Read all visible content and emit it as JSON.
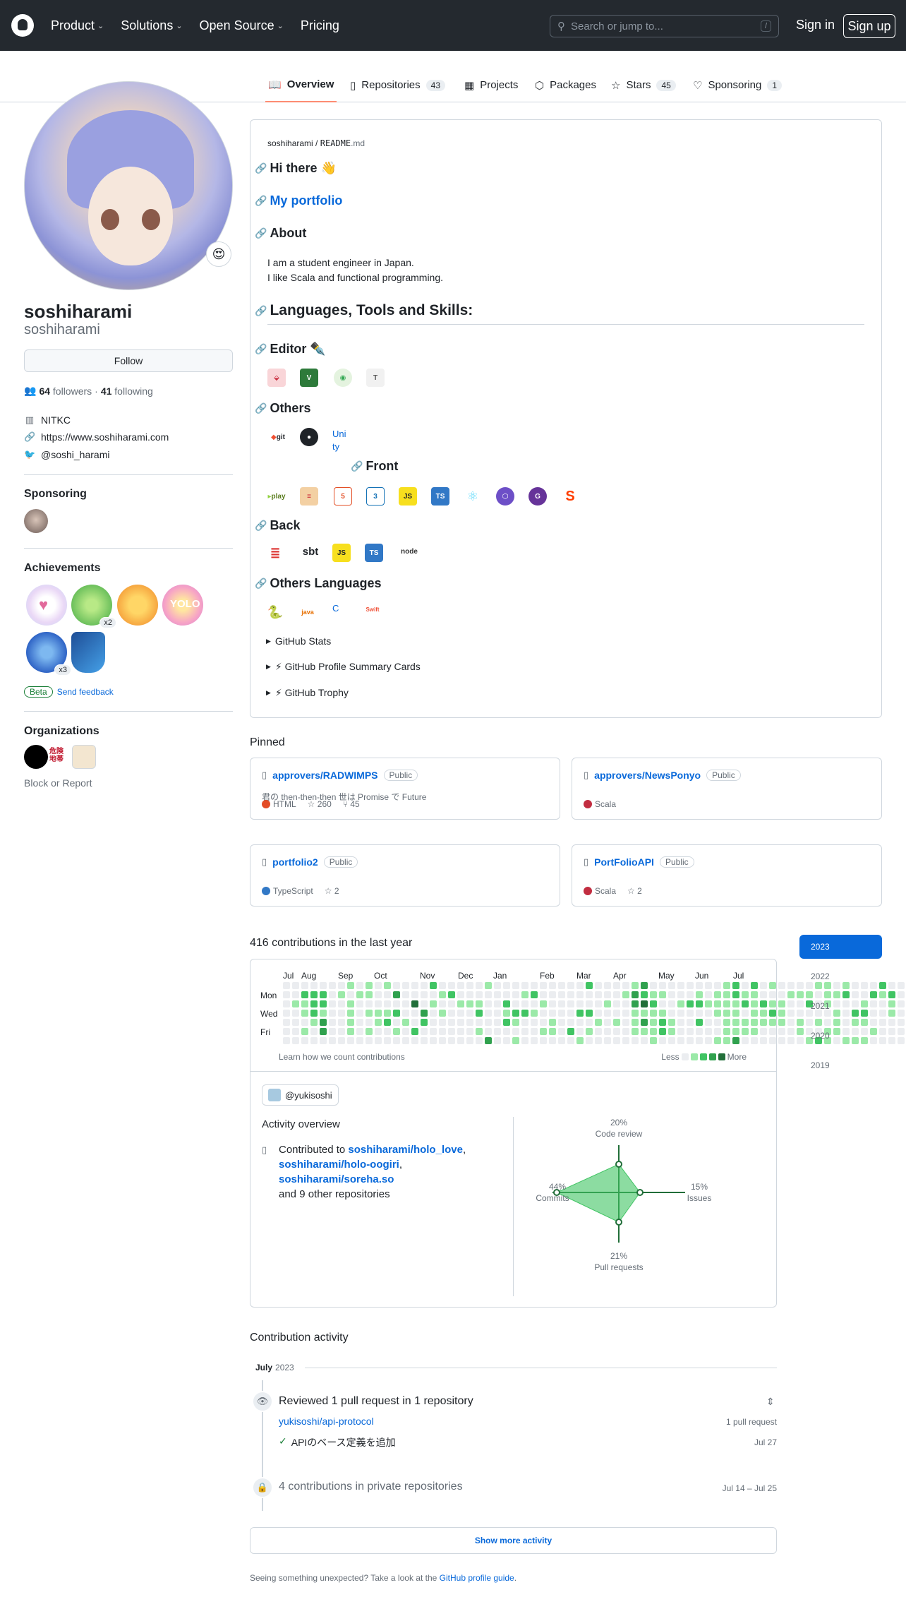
{
  "nav": {
    "product": "Product",
    "solutions": "Solutions",
    "open_source": "Open Source",
    "pricing": "Pricing",
    "search_placeholder": "Search or jump to...",
    "search_shortcut": "/",
    "sign_in": "Sign in",
    "sign_up": "Sign up"
  },
  "tabs": [
    {
      "label": "Overview",
      "count": ""
    },
    {
      "label": "Repositories",
      "count": "43"
    },
    {
      "label": "Projects",
      "count": ""
    },
    {
      "label": "Packages",
      "count": ""
    },
    {
      "label": "Stars",
      "count": "45"
    },
    {
      "label": "Sponsoring",
      "count": "1"
    }
  ],
  "profile": {
    "status_emoji": "😍",
    "name": "soshiharami",
    "login": "soshiharami",
    "follow_label": "Follow",
    "followers_count": "64",
    "followers_label": "followers",
    "dot": "·",
    "following_count": "41",
    "following_label": "following",
    "org": "NITKC",
    "website": "https://www.soshiharami.com",
    "twitter": "@soshi_harami"
  },
  "sidebar": {
    "sponsoring_h": "Sponsoring",
    "achievements_h": "Achievements",
    "badge_x2": "x2",
    "badge_x3": "x3",
    "beta": "Beta",
    "send_feedback": "Send feedback",
    "organizations_h": "Organizations",
    "org_label_1": "危険\n地帯",
    "block": "Block or Report"
  },
  "readme": {
    "path_user": "soshiharami",
    "path_sep": " / ",
    "path_file": "README",
    "path_ext": ".md",
    "h_hi": "Hi there 👋",
    "h_portfolio": "My portfolio",
    "h_about": "About",
    "about_1": "I am a student engineer in Japan.",
    "about_2": "I like Scala and functional programming.",
    "h_langs": "Languages, Tools and Skills:",
    "h_editor": "Editor ✒️",
    "h_others": "Others",
    "others_git": "git",
    "unity_alt": "Uni ty",
    "h_front": "Front",
    "play": "play",
    "js": "JS",
    "ts": "TS",
    "h_back": "Back",
    "sbt": "sbt",
    "node": "node",
    "h_other_langs": "Others Languages",
    "java": "java",
    "c_alt": "C",
    "swift": "Swift",
    "det_stats": "GitHub Stats",
    "det_cards": "⚡ GitHub Profile Summary Cards",
    "det_trophy": "⚡ GitHub Trophy"
  },
  "pinned": {
    "heading": "Pinned",
    "items": [
      {
        "owner": "approvers/",
        "name": "RADWIMPS",
        "badge": "Public",
        "desc": "君の then-then-then 世は Promise で Future",
        "lang": "HTML",
        "lang_color": "#e34c26",
        "stars": "260",
        "forks": "45"
      },
      {
        "owner": "approvers/",
        "name": "NewsPonyo",
        "badge": "Public",
        "desc": "",
        "lang": "Scala",
        "lang_color": "#c22d40",
        "stars": "",
        "forks": ""
      },
      {
        "owner": "",
        "name": "portfolio2",
        "badge": "Public",
        "desc": "",
        "lang": "TypeScript",
        "lang_color": "#3178c6",
        "stars": "2",
        "forks": ""
      },
      {
        "owner": "",
        "name": "PortFolioAPI",
        "badge": "Public",
        "desc": "",
        "lang": "Scala",
        "lang_color": "#c22d40",
        "stars": "2",
        "forks": ""
      }
    ]
  },
  "contrib": {
    "heading": "416 contributions in the last year",
    "months": [
      "Jul",
      "Aug",
      "Sep",
      "Oct",
      "Nov",
      "Dec",
      "Jan",
      "Feb",
      "Mar",
      "Apr",
      "May",
      "Jun",
      "Jul"
    ],
    "days": [
      "Mon",
      "Wed",
      "Fri"
    ],
    "learn": "Learn how we count contributions",
    "less": "Less",
    "more": "More",
    "years": [
      "2023",
      "2022",
      "2021",
      "2020",
      "2019"
    ],
    "levels": [
      "0000000101010000200000100000000002000013000000001202010000110100020001",
      "0022201011003000012000000012000000000132110001011211000111011200212010",
      "0112200100000040100111002000100000010034200122111121211002010001001001",
      "0012100101112003010002001221000022000011110000011101121000001022001010",
      "0001300100120102000000002100010000101013121002001111111010101011000022",
      "0010300101001020000001000000110201000011121000001111000010011000100000",
      "0000000000000000000000300100000010000000100000011300000001210111000000"
    ],
    "palette": [
      "#ebedf0",
      "#9be9a8",
      "#40c463",
      "#30a14e",
      "#216e39"
    ]
  },
  "activity": {
    "org_chip": "@yukisoshi",
    "overview_h": "Activity overview",
    "contributed_to": "Contributed to",
    "repo1": "soshiharami/holo_love",
    "repo2": "soshiharami/holo-oogiri",
    "repo3": "soshiharami/soreha.so",
    "and_more": "and 9 other repositories",
    "code_review_pct": "20%",
    "code_review": "Code review",
    "commits_pct": "44%",
    "commits": "Commits",
    "issues_pct": "15%",
    "issues": "Issues",
    "prs_pct": "21%",
    "prs": "Pull requests",
    "radar": {
      "code_review": 20,
      "issues": 15,
      "pull_requests": 21,
      "commits": 44
    }
  },
  "timeline": {
    "heading": "Contribution activity",
    "month": "July",
    "year": "2023",
    "reviewed": "Reviewed 1 pull request in 1 repository",
    "repo": "yukisoshi/api-protocol",
    "repo_count": "1 pull request",
    "pr_title": "APIのベース定義を追加",
    "pr_date": "Jul 27",
    "private": "4 contributions in private repositories",
    "private_dates": "Jul 14 – Jul 25",
    "show_more": "Show more activity",
    "footer_1": "Seeing something unexpected? Take a look at the ",
    "footer_link": "GitHub profile guide",
    "footer_2": "."
  }
}
